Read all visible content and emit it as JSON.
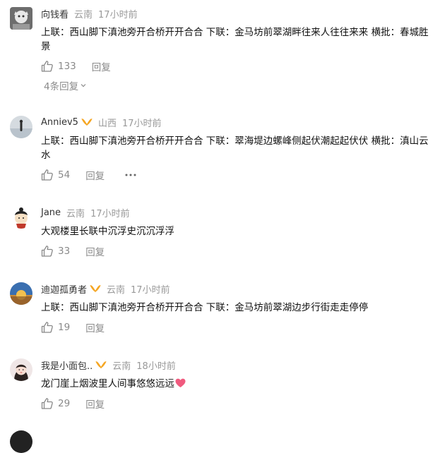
{
  "comments": [
    {
      "username": "向钱看",
      "location": "云南",
      "time": "17小时前",
      "text": "上联：西山脚下滇池旁开合桥开开合合 下联：金马坊前翠湖畔往来人往往来来 横批：春城胜景",
      "likes": "133",
      "reply_label": "回复",
      "sub_replies": "4条回复"
    },
    {
      "username": "Anniev5",
      "location": "山西",
      "time": "17小时前",
      "text": "上联：西山脚下滇池旁开合桥开开合合 下联：翠海堤边螺峰侧起伏潮起起伏伏 横批：滇山云水",
      "likes": "54",
      "reply_label": "回复"
    },
    {
      "username": "Jane",
      "location": "云南",
      "time": "17小时前",
      "text": "大观楼里长联中沉浮史沉沉浮浮",
      "likes": "33",
      "reply_label": "回复"
    },
    {
      "username": "迪迦孤勇者",
      "location": "云南",
      "time": "17小时前",
      "text": "上联：西山脚下滇池旁开合桥开开合合 下联：金马坊前翠湖边步行街走走停停",
      "likes": "19",
      "reply_label": "回复"
    },
    {
      "username": "我是小面包..",
      "location": "云南",
      "time": "18小时前",
      "text": "龙门崖上烟波里人间事悠悠远远",
      "likes": "29",
      "reply_label": "回复"
    }
  ],
  "colors": {
    "muted": "#999999",
    "text": "#111111",
    "badge": "#f5a623",
    "heart": "#f05a7e"
  },
  "icons": {
    "like": "thumbs-up-icon",
    "more": "more-dots-icon",
    "expand": "chevron-down-icon",
    "badge": "vip-badge-icon",
    "heart": "heart-icon"
  }
}
